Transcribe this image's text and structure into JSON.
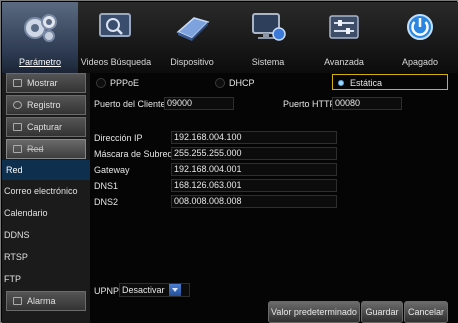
{
  "menu": {
    "tabs": [
      {
        "label": "Parámetro",
        "icon": "gears-icon"
      },
      {
        "label": "Videos Búsqueda",
        "icon": "magnifier-screen-icon"
      },
      {
        "label": "Dispositivo",
        "icon": "hard-disk-icon"
      },
      {
        "label": "Sistema",
        "icon": "monitor-lock-icon"
      },
      {
        "label": "Avanzada",
        "icon": "sliders-icon"
      },
      {
        "label": "Apagado",
        "icon": "power-icon"
      }
    ]
  },
  "sidebar": {
    "items": [
      {
        "label": "Mostrar",
        "icon": "display-icon"
      },
      {
        "label": "Registro",
        "icon": "gear-icon"
      },
      {
        "label": "Capturar",
        "icon": "capture-icon"
      },
      {
        "label": "Red",
        "icon": "network-icon"
      },
      {
        "label": "Red"
      },
      {
        "label": "Correo electrónico"
      },
      {
        "label": "Calendario"
      },
      {
        "label": "DDNS"
      },
      {
        "label": "RTSP"
      },
      {
        "label": "FTP"
      },
      {
        "label": "Alarma",
        "icon": "alarm-icon"
      }
    ]
  },
  "network": {
    "modes": [
      "PPPoE",
      "DHCP",
      "Estática"
    ],
    "selected_mode": "Estática",
    "client_port_label": "Puerto del Cliente",
    "client_port": "09000",
    "http_port_label": "Puerto HTTP",
    "http_port": "00080",
    "ip_label": "Dirección IP",
    "ip": "192.168.004.100",
    "mask_label": "Máscara de Subred",
    "mask": "255.255.255.000",
    "gateway_label": "Gateway",
    "gateway": "192.168.004.001",
    "dns1_label": "DNS1",
    "dns1": "168.126.063.001",
    "dns2_label": "DNS2",
    "dns2": "008.008.008.008",
    "upnp_label": "UPNP",
    "upnp_value": "Desactivar"
  },
  "buttons": {
    "default": "Valor predeterminado",
    "save": "Guardar",
    "cancel": "Cancelar"
  },
  "colors": {
    "accent": "#d6b200",
    "active_tab": "#2e3b52",
    "active_item": "#0f2f4e"
  }
}
